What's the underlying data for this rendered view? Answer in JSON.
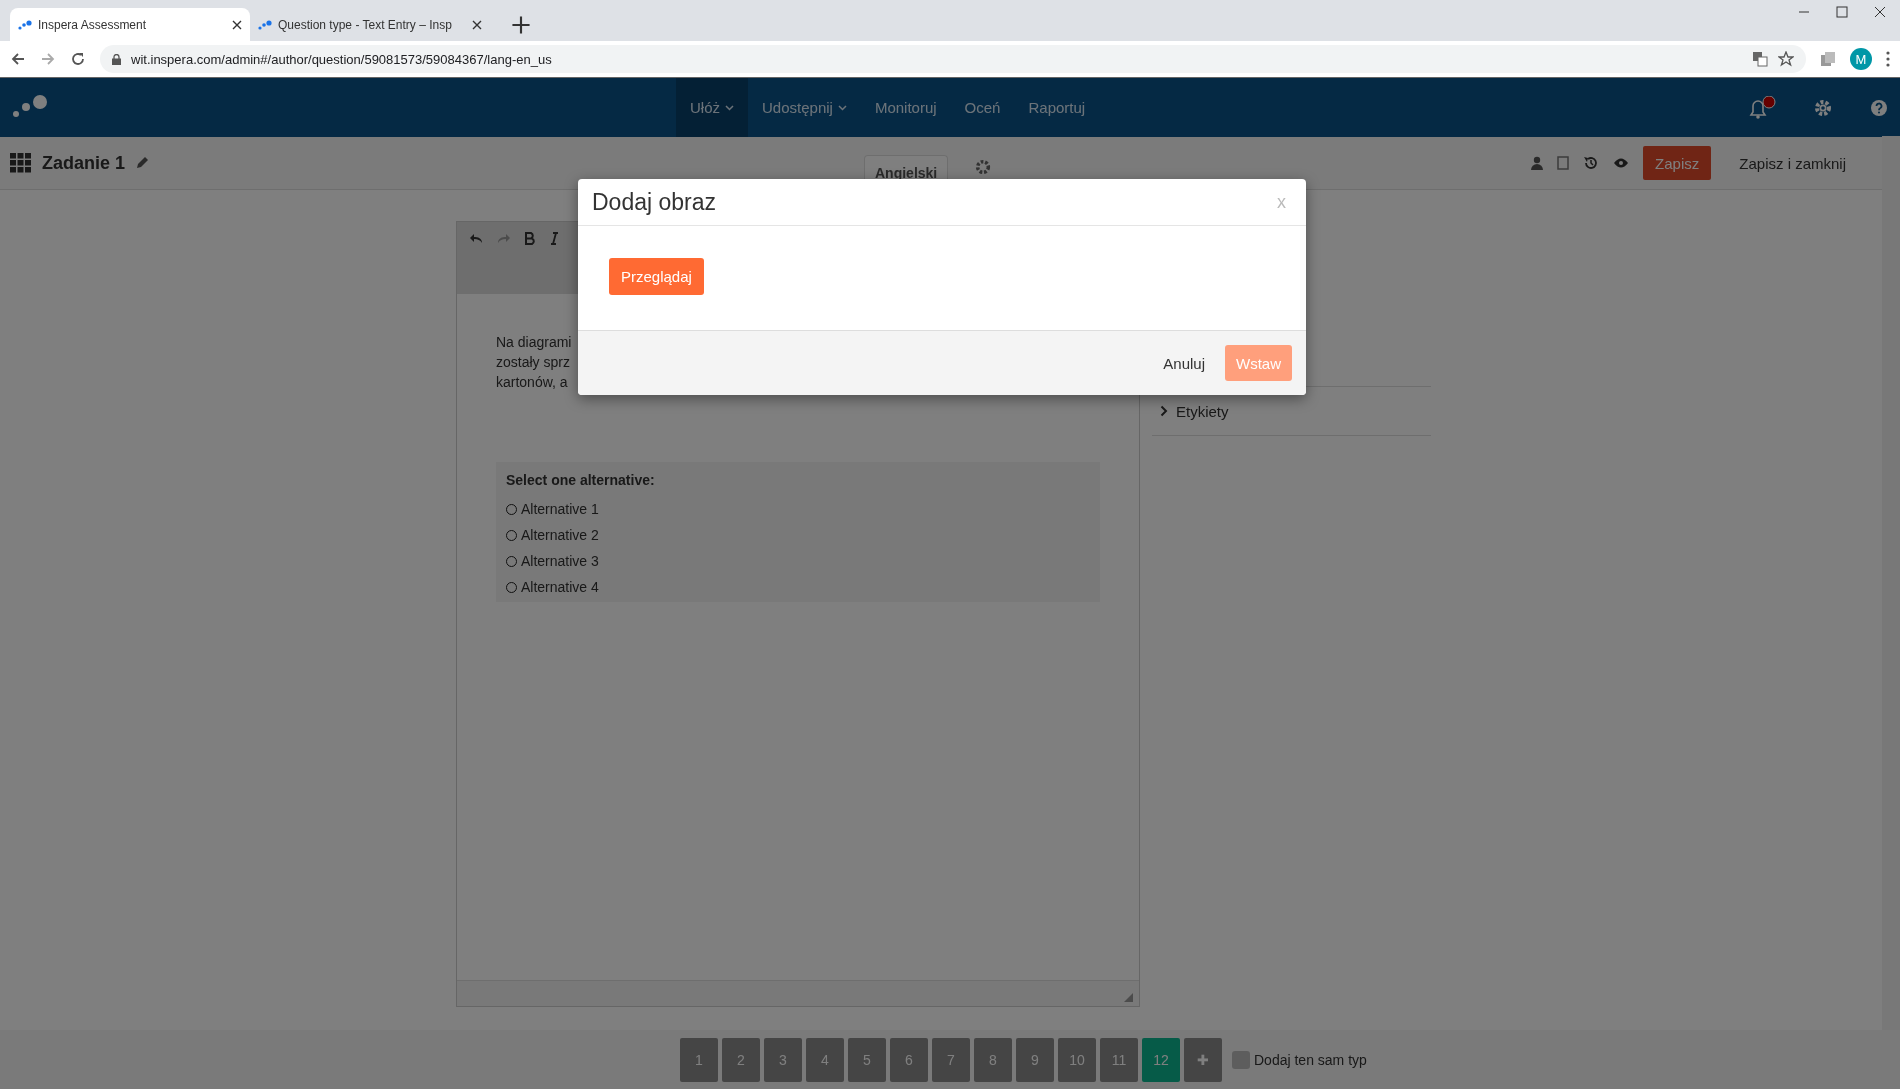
{
  "browser": {
    "tabs": [
      {
        "title": "Inspera Assessment",
        "selected": true
      },
      {
        "title": "Question type - Text Entry – Insp",
        "selected": false
      }
    ],
    "url": "wit.inspera.com/admin#/author/question/59081573/59084367/lang-en_us",
    "profile": "M"
  },
  "nav": {
    "items": [
      {
        "label": "Ułóż",
        "selected": true,
        "has_menu": true
      },
      {
        "label": "Udostępnij",
        "selected": false,
        "has_menu": true
      },
      {
        "label": "Monitoruj",
        "selected": false,
        "has_menu": false
      },
      {
        "label": "Oceń",
        "selected": false,
        "has_menu": false
      },
      {
        "label": "Raportuj",
        "selected": false,
        "has_menu": false
      }
    ]
  },
  "subheader": {
    "title": "Zadanie 1",
    "language_tab": "Angielski",
    "save": "Zapisz",
    "save_close": "Zapisz i zamknij"
  },
  "editor": {
    "text_lines": [
      "Na diagrami",
      "zostały sprz",
      "kartonów, a"
    ],
    "question": {
      "prompt": "Select one alternative:",
      "options": [
        {
          "label": "Alternative 1",
          "checked": false
        },
        {
          "label": "Alternative 2",
          "checked": false
        },
        {
          "label": "Alternative 3",
          "checked": false
        },
        {
          "label": "Alternative 4",
          "checked": false
        }
      ]
    }
  },
  "side_panel": {
    "sections": [
      "Etykiety"
    ]
  },
  "pagination": {
    "pages": [
      {
        "label": "1",
        "selected": false
      },
      {
        "label": "2",
        "selected": false
      },
      {
        "label": "3",
        "selected": false
      },
      {
        "label": "4",
        "selected": false
      },
      {
        "label": "5",
        "selected": false
      },
      {
        "label": "6",
        "selected": false
      },
      {
        "label": "7",
        "selected": false
      },
      {
        "label": "8",
        "selected": false
      },
      {
        "label": "9",
        "selected": false
      },
      {
        "label": "10",
        "selected": false
      },
      {
        "label": "11",
        "selected": false
      },
      {
        "label": "12",
        "selected": true
      }
    ],
    "add": "✚",
    "same_type": {
      "label": "Dodaj ten sam typ",
      "checked": false
    }
  },
  "modal": {
    "title": "Dodaj obraz",
    "close": "x",
    "browse": "Przeglądaj",
    "cancel": "Anuluj",
    "insert": "Wstaw"
  }
}
